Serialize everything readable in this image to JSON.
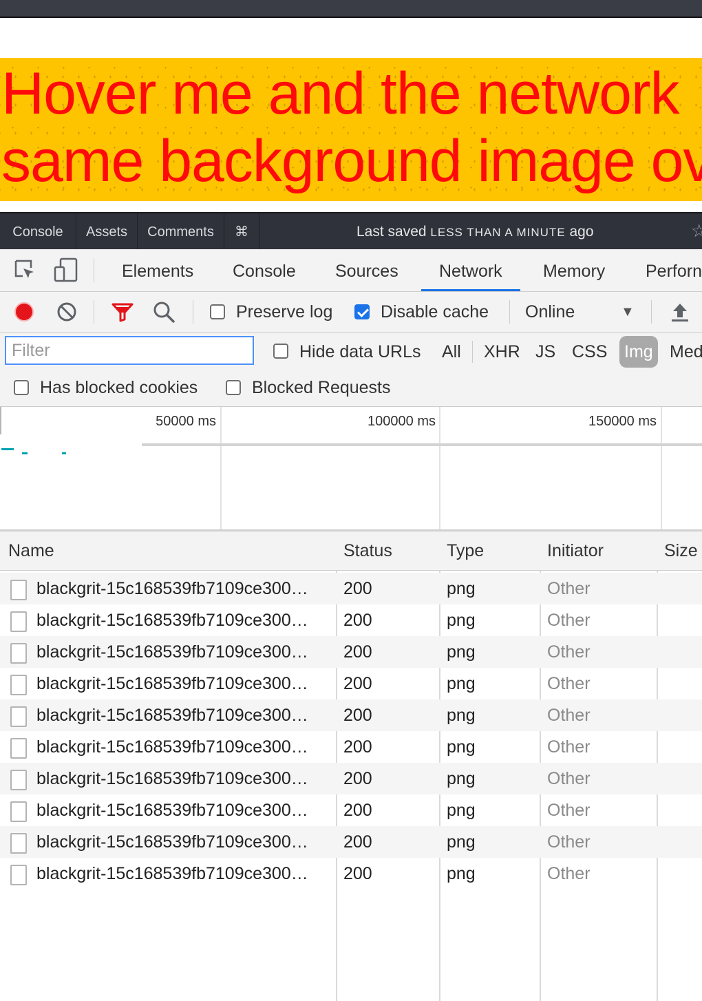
{
  "banner": {
    "line1": "Hover me and the network",
    "line2": "same background image ov"
  },
  "codepen_bar": {
    "tabs": [
      "Console",
      "Assets",
      "Comments",
      "⌘"
    ],
    "saved_prefix": "Last saved",
    "saved_caps": "less than a minute",
    "saved_suffix": "ago",
    "star": "☆"
  },
  "devtools": {
    "tabs": [
      "Elements",
      "Console",
      "Sources",
      "Network",
      "Memory",
      "Perforn"
    ],
    "active_tab": "Network"
  },
  "toolbar": {
    "preserve_log_label": "Preserve log",
    "preserve_log_checked": false,
    "disable_cache_label": "Disable cache",
    "disable_cache_checked": true,
    "throttling_value": "Online",
    "record_color": "#e3151a"
  },
  "filter": {
    "placeholder": "Filter",
    "value": "",
    "hide_data_urls_label": "Hide data URLs",
    "types": [
      "All",
      "XHR",
      "JS",
      "CSS",
      "Img",
      "Med"
    ],
    "active_type": "Img",
    "has_blocked_cookies_label": "Has blocked cookies",
    "blocked_requests_label": "Blocked Requests"
  },
  "overview": {
    "ticks": [
      "50000 ms",
      "100000 ms",
      "150000 ms"
    ],
    "bar_color": "#00a3b0"
  },
  "table": {
    "columns": [
      "Name",
      "Status",
      "Type",
      "Initiator",
      "Size"
    ],
    "rows": [
      {
        "name": "blackgrit-15c168539fb7109ce300…",
        "status": "200",
        "type": "png",
        "initiator": "Other"
      },
      {
        "name": "blackgrit-15c168539fb7109ce300…",
        "status": "200",
        "type": "png",
        "initiator": "Other"
      },
      {
        "name": "blackgrit-15c168539fb7109ce300…",
        "status": "200",
        "type": "png",
        "initiator": "Other"
      },
      {
        "name": "blackgrit-15c168539fb7109ce300…",
        "status": "200",
        "type": "png",
        "initiator": "Other"
      },
      {
        "name": "blackgrit-15c168539fb7109ce300…",
        "status": "200",
        "type": "png",
        "initiator": "Other"
      },
      {
        "name": "blackgrit-15c168539fb7109ce300…",
        "status": "200",
        "type": "png",
        "initiator": "Other"
      },
      {
        "name": "blackgrit-15c168539fb7109ce300…",
        "status": "200",
        "type": "png",
        "initiator": "Other"
      },
      {
        "name": "blackgrit-15c168539fb7109ce300…",
        "status": "200",
        "type": "png",
        "initiator": "Other"
      },
      {
        "name": "blackgrit-15c168539fb7109ce300…",
        "status": "200",
        "type": "png",
        "initiator": "Other"
      },
      {
        "name": "blackgrit-15c168539fb7109ce300…",
        "status": "200",
        "type": "png",
        "initiator": "Other"
      }
    ]
  }
}
